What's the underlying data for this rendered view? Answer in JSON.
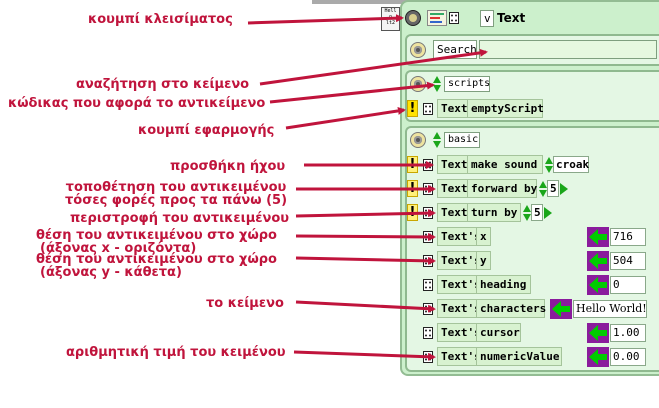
{
  "header": {
    "menu_char": "v",
    "object_name": "Text",
    "mini_label_1": "Hell",
    "mini_label_2": "o",
    "mini_label_3": "lt2"
  },
  "search": {
    "label": "Search",
    "value": ""
  },
  "scripts_category": {
    "name": "scripts",
    "row": {
      "receiver": "Text",
      "command": "emptyScript"
    }
  },
  "basic_category": {
    "name": "basic",
    "rows": [
      {
        "receiver": "Text",
        "command": "make sound",
        "arg": "croak"
      },
      {
        "receiver": "Text",
        "command": "forward by",
        "arg": "5"
      },
      {
        "receiver": "Text",
        "command": "turn by",
        "arg": "5"
      },
      {
        "receiver": "Text's",
        "property": "x",
        "value": "716"
      },
      {
        "receiver": "Text's",
        "property": "y",
        "value": "504"
      },
      {
        "receiver": "Text's",
        "property": "heading",
        "value": "0"
      },
      {
        "receiver": "Text's",
        "property": "characters",
        "value": "Hello World!"
      },
      {
        "receiver": "Text's",
        "property": "cursor",
        "value": "1.00"
      },
      {
        "receiver": "Text's",
        "property": "numericValue",
        "value": "0.00"
      }
    ]
  },
  "annotations": {
    "close_button": "κουμπί κλεισίματος",
    "search_text": "αναζήτηση στο κείμενο",
    "object_code": "κώδικας που αφορά το αντικείμενο",
    "apply_button": "κουμπί εφαρμογής",
    "add_sound": "προσθήκη ήχου",
    "move_forward_line1": "τοποθέτηση του αντικειμένου",
    "move_forward_line2": "τόσες φορές προς τα πάνω (5)",
    "rotate": "περιστροφή του αντικειμένου",
    "pos_x_line1": "θέση του αντικειμένου στο χώρο",
    "pos_x_line2": "(άξονας x - οριζόντα)",
    "pos_y_line1": "θέση του αντικειμένου στο χώρο",
    "pos_y_line2": "(άξονας y - κάθετα)",
    "the_text": "το κείμενο",
    "numeric_value": "αριθμητική τιμή του κειμένου"
  },
  "colors": {
    "annotation": "#c0143c",
    "panel_bg": "#ccf0cc",
    "tile_bg": "#d8f2d0",
    "exclaim": "#ffe200",
    "arrow_green": "#00cc00",
    "arrow_bg": "#8a1b9c"
  }
}
